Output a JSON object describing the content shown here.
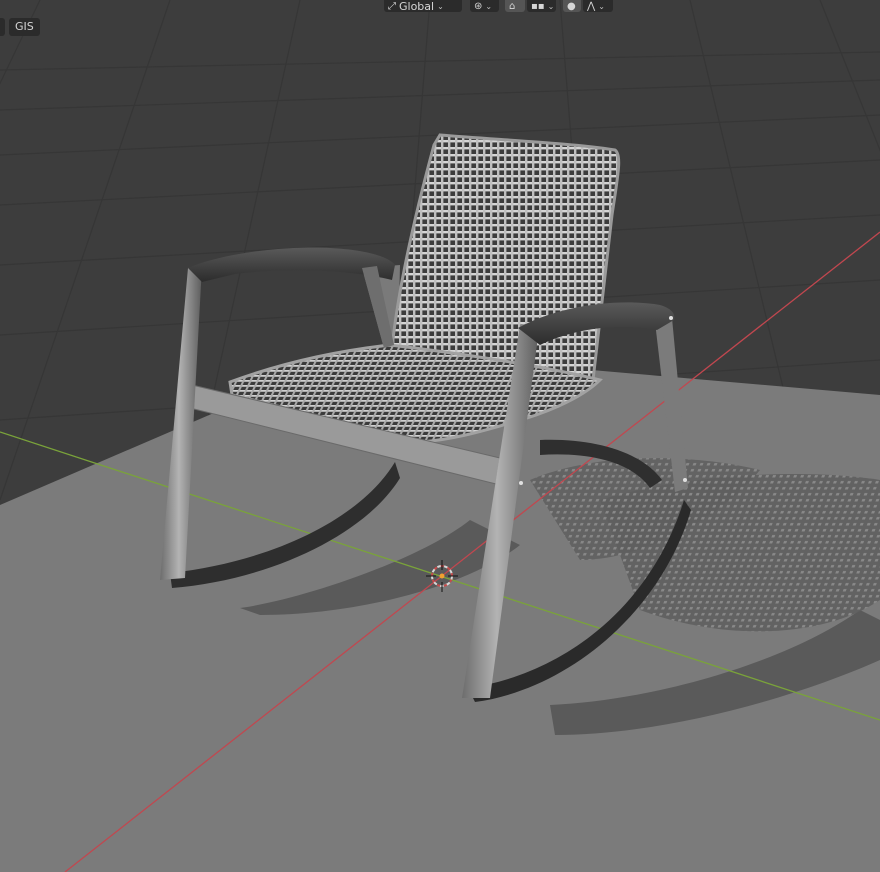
{
  "app": "Blender",
  "viewport": {
    "object": "rocking-chair",
    "transform_orientation": "Global",
    "sidebar_tab": "GIS"
  },
  "icons": [
    "transform-orientation-icon",
    "pivot-point-icon",
    "snap-icon",
    "snap-target-icon",
    "proportional-edit-icon",
    "falloff-icon",
    "3d-cursor-icon"
  ],
  "colors": {
    "grid_background": "#3d3d3d",
    "floor_plane": "#7b7b7b",
    "x_axis": "#c1474f",
    "y_axis": "#7aa33a",
    "header_bg": "#2b2b2b",
    "chair_frame": "#8f8f8f",
    "wicker": "#cfcfcf"
  }
}
